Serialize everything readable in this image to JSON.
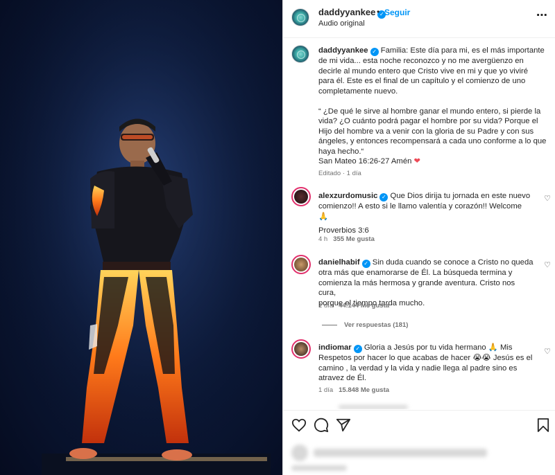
{
  "post": {
    "username": "daddyyankee",
    "verified_mark": "✓",
    "dot": "•",
    "follow_label": "Seguir",
    "audio_label": "Audio original",
    "more_icon": "⋯"
  },
  "caption": {
    "username": "daddyyankee",
    "lines": [
      "Familia: Este día para mi, es el más importante",
      "de mi vida... esta noche reconozco y no me avergüenzo en",
      "decirle al mundo entero que Cristo vive en mi y que yo viviré",
      "para él. Este es el final de un capítulo y el comienzo de uno",
      "completamente nuevo.",
      "",
      "“ ¿De qué le sirve al hombre ganar el mundo entero, si pierde la",
      "vida? ¿O cuánto podrá pagar el hombre por su vida? Porque el",
      "Hijo del hombre va a venir con la gloria de su Padre y con sus",
      "ángeles, y entonces recompensará a cada uno conforme a lo que",
      "haya hecho.“",
      "San Mateo 16:26-27 Amén"
    ],
    "heart": "❤",
    "edited": "Editado · 1 día"
  },
  "comments": [
    {
      "username": "alexzurdomusic",
      "lines": [
        "Que Dios dirija tu jornada en este nuevo",
        "comienzo!! A esto si le llamo valentía y corazón!! Welcome 🙏",
        "",
        "Proverbios 3:6"
      ],
      "time": "4 h",
      "likes": "355 Me gusta"
    },
    {
      "username": "danielhabif",
      "lines": [
        "Sin duda cuando se conoce a Cristo no queda",
        "otra más que enamorarse de Él. La búsqueda termina y",
        "comienza la más hermosa y grande aventura. Cristo nos cura,",
        "porque el tiempo tarda mucho."
      ],
      "time": "1 día",
      "likes": "44.144 Me gusta",
      "replies": "Ver respuestas (181)"
    },
    {
      "username": "indiomar",
      "lines": [
        "Gloria a Jesús por tu vida hermano 🙏 Mis",
        "Respetos por hacer lo que acabas de hacer 😭😭 Jesús es el",
        "camino , la verdad y la vida y nadie llega al padre sino es",
        "atravez de Él."
      ],
      "time": "1 día",
      "likes": "15.848 Me gusta"
    }
  ],
  "like_icon": "♡",
  "colors": {
    "accent": "#0095f6",
    "heart": "#ed4956",
    "ring": "#e1306c"
  }
}
